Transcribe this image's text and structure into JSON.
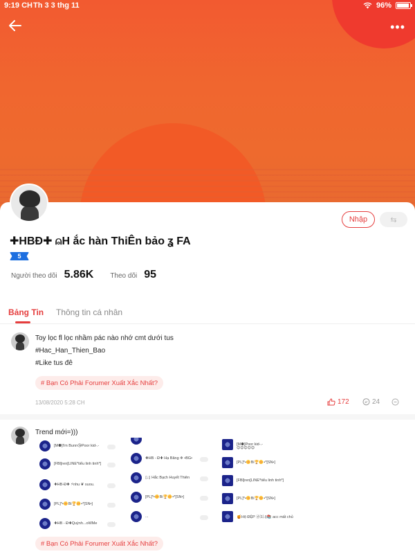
{
  "status_bar": {
    "time": "9:19 CH",
    "date": "Th 3 3 thg 11",
    "battery": "96%"
  },
  "profile": {
    "name": "✚HBĐ✚ ⍝H ắc hàn ThiÊn bảo ʓ FA",
    "level": "5",
    "followers_label": "Người theo dõi",
    "followers_value": "5.86K",
    "following_label": "Theo dõi",
    "following_value": "95",
    "join_label": "Nhập",
    "swap_icon": "⇆"
  },
  "tabs": [
    {
      "label": "Bảng Tin",
      "active": true
    },
    {
      "label": "Thông tin cá nhân",
      "active": false
    }
  ],
  "posts": [
    {
      "lines": [
        "Toy lọc fl lọc nhầm pác nào nhớ cmt dưới tus",
        "#Hac_Han_Thien_Bao",
        "#Like tus đê"
      ],
      "hashtag": "# Bạn Có Phải Forumer Xuất Xắc Nhất?",
      "date": "13/08/2020 5:28 CH",
      "likes": "172",
      "comments": "24"
    },
    {
      "lines": [
        "Trend mới=)))"
      ],
      "hashtag": "# Bạn Có Phải Forumer Xuất Xắc Nhất?"
    }
  ],
  "embedded_screenshot": {
    "col1": [
      "[M⚉]I'm Bunn😘Poor kid-.-",
      "[FBl]ren[LINE*tiểu linh tinh*]",
      "✚HB-Đ✚ ⚡nhu ❦ suou.",
      "[PL]*•🌼Bi🏆🌼•*[SN•]",
      "✚HB - Đ✚Quỳnh...oWMe"
    ],
    "col2": [
      "✚HB - Đ✚ Hạ Băng ❄ •BG•",
      "▯.▯ Hắc Bạch Huyết Thiên",
      "[PL]*•🌼Bi🏆🌼•*[SN•]",
      "..."
    ],
    "col3": [
      "[M⚉]Poor kid-.-",
      "😊😊😊😊😊",
      "[PL]*•🌼Bi🏆🌼•*[SN•]",
      "[FBl]ren[LINE*tiểu linh tinh*]",
      "[PL]*•🌼Bi🏆🌼•*[SN•]",
      "🍯Hộ ĐỆP ⓓ⑴.i)📚 acc mất chủ"
    ]
  },
  "colors": {
    "accent": "#e53d3d",
    "hero": "#f0662f",
    "level_badge": "#1d6fe0"
  }
}
